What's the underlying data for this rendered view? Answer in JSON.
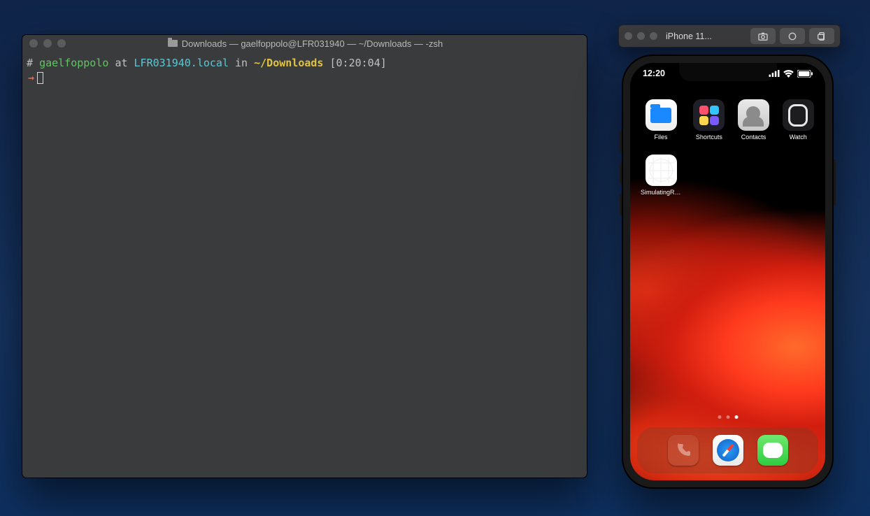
{
  "terminal": {
    "title": "Downloads — gaelfoppolo@LFR031940 — ~/Downloads — -zsh",
    "prompt": {
      "hash": "#",
      "user": "gaelfoppolo",
      "at": "at",
      "host": "LFR031940.local",
      "in": "in",
      "path": "~/Downloads",
      "time": "[0:20:04]"
    },
    "arrow": "→"
  },
  "simulator": {
    "title": "iPhone 11...",
    "buttons": {
      "screenshot": "screenshot",
      "home": "home",
      "rotate": "rotate"
    }
  },
  "phone": {
    "clock": "12:20",
    "apps": [
      {
        "name": "Files"
      },
      {
        "name": "Shortcuts"
      },
      {
        "name": "Contacts"
      },
      {
        "name": "Watch"
      },
      {
        "name": "SimulatingRem..."
      }
    ],
    "dock": [
      {
        "name": "Phone"
      },
      {
        "name": "Safari"
      },
      {
        "name": "Messages"
      }
    ],
    "pages": {
      "count": 3,
      "active": 3
    }
  }
}
